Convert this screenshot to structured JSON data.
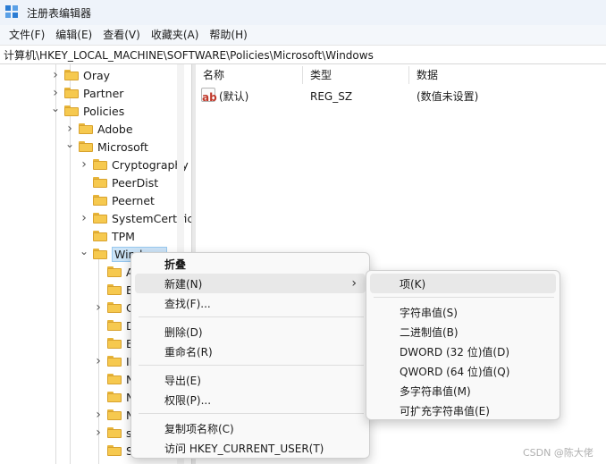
{
  "window": {
    "title": "注册表编辑器",
    "icon": "regedit-icon"
  },
  "menubar": {
    "items": [
      "文件(F)",
      "编辑(E)",
      "查看(V)",
      "收藏夹(A)",
      "帮助(H)"
    ]
  },
  "address": {
    "path": "计算机\\HKEY_LOCAL_MACHINE\\SOFTWARE\\Policies\\Microsoft\\Windows"
  },
  "tree": {
    "nodes": [
      {
        "label": "Oray",
        "expander": "collapsed"
      },
      {
        "label": "Partner",
        "expander": "collapsed"
      },
      {
        "label": "Policies",
        "expander": "expanded"
      },
      {
        "label": "Adobe",
        "expander": "collapsed"
      },
      {
        "label": "Microsoft",
        "expander": "expanded"
      },
      {
        "label": "Cryptography",
        "expander": "collapsed"
      },
      {
        "label": "PeerDist",
        "expander": "none"
      },
      {
        "label": "Peernet",
        "expander": "none"
      },
      {
        "label": "SystemCertificates",
        "expander": "collapsed"
      },
      {
        "label": "TPM",
        "expander": "none"
      },
      {
        "label": "Windows",
        "expander": "expanded",
        "selected": true
      },
      {
        "label": "A",
        "expander": "none"
      },
      {
        "label": "B",
        "expander": "none"
      },
      {
        "label": "C",
        "expander": "collapsed"
      },
      {
        "label": "D",
        "expander": "none"
      },
      {
        "label": "E",
        "expander": "none"
      },
      {
        "label": "IP",
        "expander": "collapsed"
      },
      {
        "label": "N",
        "expander": "none"
      },
      {
        "label": "N",
        "expander": "none"
      },
      {
        "label": "N",
        "expander": "collapsed"
      },
      {
        "label": "sa",
        "expander": "collapsed"
      },
      {
        "label": "Sy",
        "expander": "none"
      }
    ]
  },
  "list": {
    "columns": {
      "name": "名称",
      "type": "类型",
      "data": "数据"
    },
    "rows": [
      {
        "icon": "string-value-icon",
        "name": "(默认)",
        "type": "REG_SZ",
        "data": "(数值未设置)"
      }
    ]
  },
  "context_menu": {
    "items": [
      {
        "label": "折叠",
        "bold": true
      },
      {
        "label": "新建(N)",
        "submenu": true,
        "hover": true
      },
      {
        "label": "查找(F)..."
      },
      {
        "separator": true
      },
      {
        "label": "删除(D)"
      },
      {
        "label": "重命名(R)"
      },
      {
        "separator": true
      },
      {
        "label": "导出(E)"
      },
      {
        "label": "权限(P)..."
      },
      {
        "separator": true
      },
      {
        "label": "复制项名称(C)"
      },
      {
        "label": "访问 HKEY_CURRENT_USER(T)"
      }
    ]
  },
  "submenu": {
    "items": [
      {
        "label": "项(K)",
        "hover": true
      },
      {
        "separator": true
      },
      {
        "label": "字符串值(S)"
      },
      {
        "label": "二进制值(B)"
      },
      {
        "label": "DWORD (32 位)值(D)"
      },
      {
        "label": "QWORD (64 位)值(Q)"
      },
      {
        "label": "多字符串值(M)"
      },
      {
        "label": "可扩充字符串值(E)"
      }
    ]
  },
  "watermark": "CSDN @陈大佬",
  "colors": {
    "accent": "#2b7cd3",
    "selection": "#cce4f7",
    "folder": "#f6c94f"
  }
}
